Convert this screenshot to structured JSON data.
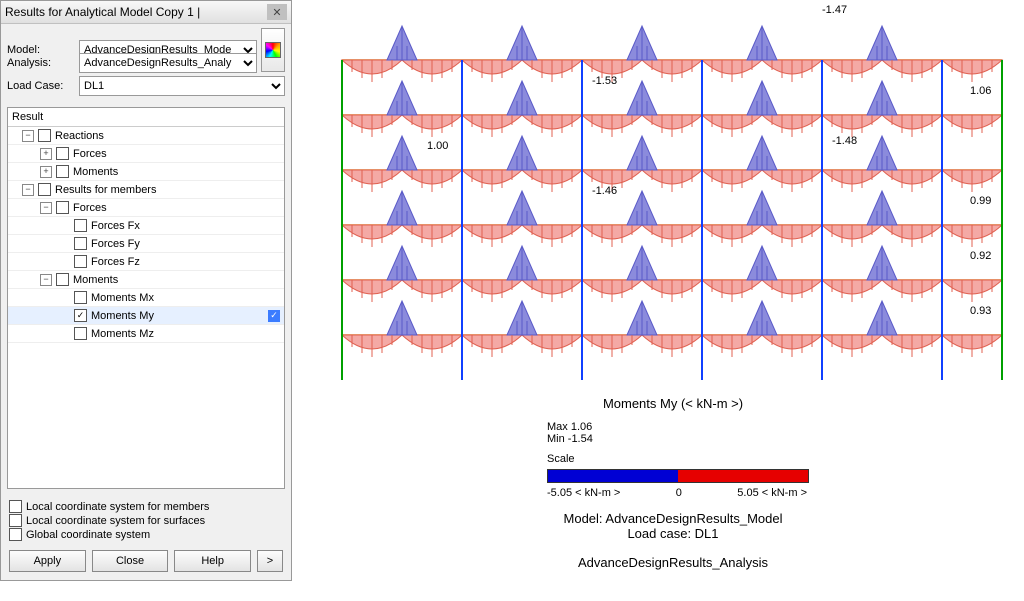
{
  "panel": {
    "title": "Results for Analytical Model Copy 1 |",
    "form": {
      "model_label": "Model:",
      "model_value": "AdvanceDesignResults_Mode",
      "analysis_label": "Analysis:",
      "analysis_value": "AdvanceDesignResults_Analy",
      "loadcase_label": "Load Case:",
      "loadcase_value": "DL1"
    },
    "tree": {
      "header": "Result",
      "items": [
        {
          "indent": 0,
          "expander": "-",
          "chk": false,
          "label": "Reactions"
        },
        {
          "indent": 1,
          "expander": "+",
          "chk": false,
          "label": "Forces"
        },
        {
          "indent": 1,
          "expander": "+",
          "chk": false,
          "label": "Moments"
        },
        {
          "indent": 0,
          "expander": "-",
          "chk": false,
          "label": "Results for members"
        },
        {
          "indent": 1,
          "expander": "-",
          "chk": false,
          "label": "Forces"
        },
        {
          "indent": 2,
          "expander": "",
          "chk": false,
          "label": "Forces Fx"
        },
        {
          "indent": 2,
          "expander": "",
          "chk": false,
          "label": "Forces Fy"
        },
        {
          "indent": 2,
          "expander": "",
          "chk": false,
          "label": "Forces Fz"
        },
        {
          "indent": 1,
          "expander": "-",
          "chk": false,
          "label": "Moments"
        },
        {
          "indent": 2,
          "expander": "",
          "chk": false,
          "label": "Moments Mx"
        },
        {
          "indent": 2,
          "expander": "",
          "chk": true,
          "label": "Moments My",
          "highlight": true
        },
        {
          "indent": 2,
          "expander": "",
          "chk": false,
          "label": "Moments Mz"
        }
      ]
    },
    "options": {
      "opt1": "Local coordinate system for members",
      "opt2": "Local coordinate system for surfaces",
      "opt3": "Global coordinate system"
    },
    "buttons": {
      "apply": "Apply",
      "close": "Close",
      "help": "Help",
      "more": ">"
    }
  },
  "viewer": {
    "annotations": {
      "top": "-1.47",
      "a1": "-1.53",
      "a2": "1.06",
      "a3": "1.00",
      "a4": "-1.48",
      "a5": "-1.46",
      "a6": "0.99",
      "a7": "0.92",
      "a8": "0.93"
    },
    "axis_title": "Moments My (< kN-m >)",
    "max_label": "Max 1.06",
    "min_label": "Min -1.54",
    "scale_label": "Scale",
    "scale_min": "-5.05 < kN-m >",
    "scale_mid": "0",
    "scale_max": "5.05 < kN-m >",
    "model_line": "Model: AdvanceDesignResults_Model",
    "loadcase_line": "Load case: DL1",
    "analysis_line": "AdvanceDesignResults_Analysis"
  }
}
